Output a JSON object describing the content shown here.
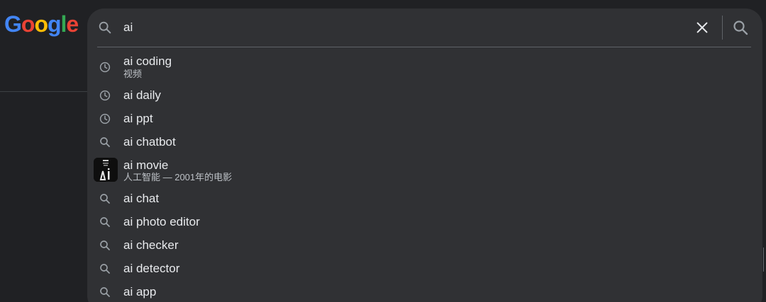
{
  "logo": {
    "text": "Google"
  },
  "search": {
    "query": "ai"
  },
  "suggestions": [
    {
      "text": "ai coding",
      "sub": "视频",
      "icon": "history-icon"
    },
    {
      "text": "ai daily",
      "icon": "history-icon"
    },
    {
      "text": "ai ppt",
      "icon": "history-icon"
    },
    {
      "text": "ai chatbot",
      "icon": "search-icon"
    },
    {
      "text": "ai movie",
      "sub": "人工智能 — 2001年的电影",
      "icon": "movie-poster-thumbnail"
    },
    {
      "text": "ai chat",
      "icon": "search-icon"
    },
    {
      "text": "ai photo editor",
      "icon": "search-icon"
    },
    {
      "text": "ai checker",
      "icon": "search-icon"
    },
    {
      "text": "ai detector",
      "icon": "search-icon"
    },
    {
      "text": "ai app",
      "icon": "search-icon"
    }
  ],
  "colors": {
    "background": "#202124",
    "searchbox": "#303134",
    "text": "#e8eaed",
    "subtext": "#bdc1c6",
    "icon": "#9aa0a6"
  }
}
